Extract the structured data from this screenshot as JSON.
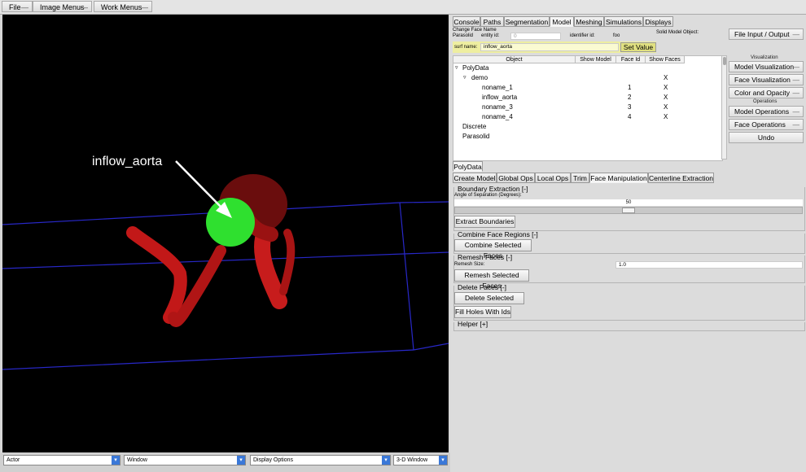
{
  "menubar": {
    "items": [
      "File",
      "Image Menus",
      "Work Menus"
    ]
  },
  "viewport": {
    "annotation": "inflow_aorta"
  },
  "bottombar": {
    "combos": [
      "Actor",
      "Window",
      "Display Options",
      "3-D Window"
    ]
  },
  "tabs": {
    "top": [
      "Console",
      "Paths",
      "Segmentation",
      "Model",
      "Meshing",
      "Simulations",
      "Displays"
    ],
    "active_top": "Model",
    "sub": [
      "PolyData"
    ],
    "tools": [
      "Create Model",
      "Global Ops",
      "Local Ops",
      "Trim",
      "Face Manipulation",
      "Centerline Extraction"
    ]
  },
  "face_name": {
    "title": "Change Face Name",
    "model_type": "Parasolid",
    "entity_label": "entity id:",
    "entity_value": "0",
    "identifier_label": "identifier id:",
    "identifier_value": "foo",
    "surf_label": "surf name:",
    "surf_value": "inflow_aorta",
    "set_value": "Set Value",
    "solid_label": "Solid Model Object:"
  },
  "side": {
    "file_io": "File Input / Output",
    "vis_label": "Visualization",
    "vis_buttons": [
      "Model Visualization",
      "Face Visualization",
      "Color and Opacity"
    ],
    "ops_label": "Operations",
    "ops_buttons": [
      "Model Operations",
      "Face Operations"
    ],
    "undo": "Undo"
  },
  "tree": {
    "headers": [
      "Object",
      "Show Model",
      "Face Id",
      "Show Faces"
    ],
    "root": "PolyData",
    "demo": "demo",
    "faces": [
      {
        "name": "noname_1",
        "id": "1",
        "show": "X"
      },
      {
        "name": "inflow_aorta",
        "id": "2",
        "show": "X"
      },
      {
        "name": "noname_3",
        "id": "3",
        "show": "X"
      },
      {
        "name": "noname_4",
        "id": "4",
        "show": "X"
      }
    ],
    "demo_show": "X",
    "others": [
      "Discrete",
      "Parasolid"
    ]
  },
  "boundary": {
    "title": "Boundary Extraction [-]",
    "angle_label": "Angle of Separation (Degrees):",
    "angle_value": "50",
    "angle_fraction": 0.5,
    "button": "Extract Boundaries"
  },
  "combine": {
    "title": "Combine Face Regions [-]",
    "button": "Combine Selected Faces"
  },
  "remesh": {
    "title": "Remesh Faces [-]",
    "size_label": "Remesh Size:",
    "size_value": "1.0",
    "button": "Remesh Selected Faces"
  },
  "delete": {
    "title": "Delete Faces [-]",
    "button1": "Delete Selected Faces",
    "button2": "Fill Holes With Ids"
  },
  "helper": {
    "title": "Helper [+]"
  }
}
